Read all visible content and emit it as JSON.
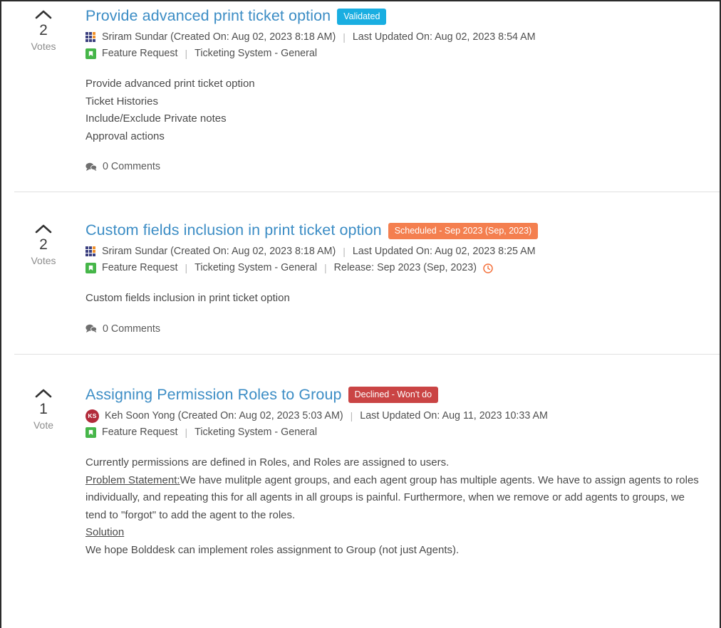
{
  "theme": {
    "link_color": "#3c8dc5",
    "badge_validated_color": "#19aee1",
    "badge_scheduled_color": "#f47f4f",
    "badge_declined_color": "#ca4444",
    "type_icon_color": "#46b649",
    "avatar_initials_color": "#b22a3a",
    "clock_icon_color": "#f4713c"
  },
  "feed": {
    "items": [
      {
        "votes": {
          "count": "2",
          "label": "Votes"
        },
        "title": "Provide advanced print ticket option",
        "badge": {
          "label": "Validated",
          "style": "validated"
        },
        "author": "Sriram Sundar (Created On: Aug 02, 2023 8:18 AM)",
        "avatar_type": "grid",
        "last_updated": "Last Updated On: Aug 02, 2023 8:54 AM",
        "type": "Feature Request",
        "category": "Ticketing System - General",
        "release": null,
        "description_lines": [
          "Provide advanced print ticket option",
          "Ticket Histories",
          "Include/Exclude Private notes",
          "Approval actions"
        ],
        "comments": "0 Comments"
      },
      {
        "votes": {
          "count": "2",
          "label": "Votes"
        },
        "title": "Custom fields inclusion in print ticket option",
        "badge": {
          "label": "Scheduled - Sep 2023 (Sep, 2023)",
          "style": "scheduled"
        },
        "author": "Sriram Sundar (Created On: Aug 02, 2023 8:18 AM)",
        "avatar_type": "grid",
        "last_updated": "Last Updated On: Aug 02, 2023 8:25 AM",
        "type": "Feature Request",
        "category": "Ticketing System - General",
        "release": "Release: Sep 2023 (Sep, 2023)",
        "description_lines": [
          "Custom fields inclusion in print ticket option"
        ],
        "comments": "0 Comments"
      },
      {
        "votes": {
          "count": "1",
          "label": "Vote"
        },
        "title": "Assigning Permission Roles to Group",
        "badge": {
          "label": "Declined - Won't do",
          "style": "declined"
        },
        "author": "Keh Soon Yong (Created On: Aug 02, 2023 5:03 AM)",
        "avatar_type": "initials",
        "avatar_initials": "KS",
        "last_updated": "Last Updated On: Aug 11, 2023 10:33 AM",
        "type": "Feature Request",
        "category": "Ticketing System - General",
        "release": null,
        "description_paragraphs": [
          {
            "text": "Currently permissions are defined in Roles, and Roles are assigned to users."
          },
          {
            "underlined_prefix": "Problem Statement:",
            "text": "We have mulitple agent groups, and each agent group has multiple agents. We have to assign agents to roles individually, and repeating this for all agents in all groups is painful. Furthermore, when we remove or add agents to groups, we tend to \"forgot\" to add the agent to the roles."
          },
          {
            "underlined_prefix": "Solution",
            "text": ""
          },
          {
            "text": "We hope Bolddesk can implement roles assignment to Group (not just Agents)."
          }
        ],
        "comments": null
      }
    ],
    "separators": {
      "pipe": "|"
    }
  }
}
